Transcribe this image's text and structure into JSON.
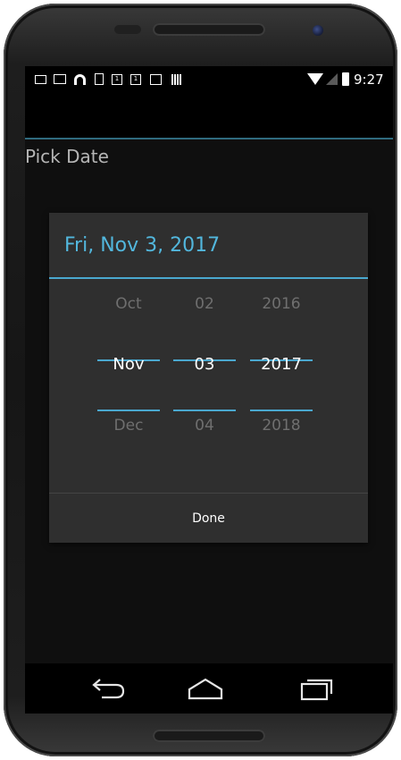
{
  "statusbar": {
    "time": "9:27",
    "icons": [
      "image-icon",
      "mail-icon",
      "headset-icon",
      "download-icon",
      "calendar-icon",
      "calendar-icon",
      "bag-icon",
      "barcode-icon",
      "wifi-icon",
      "signal-icon",
      "battery-icon"
    ],
    "cal_day": "1"
  },
  "screen": {
    "title": "Pick Date"
  },
  "dialog": {
    "header": "Fri, Nov 3, 2017",
    "month": {
      "prev": "Oct",
      "current": "Nov",
      "next": "Dec"
    },
    "day": {
      "prev": "02",
      "current": "03",
      "next": "04"
    },
    "year": {
      "prev": "2016",
      "current": "2017",
      "next": "2018"
    },
    "done_label": "Done"
  },
  "navbar": {
    "buttons": [
      "back-icon",
      "home-icon",
      "recent-apps-icon"
    ]
  },
  "colors": {
    "accent": "#4aa8cf",
    "header_text": "#52b7dd",
    "dialog_bg": "#2f2f2f",
    "screen_bg": "#101010"
  }
}
